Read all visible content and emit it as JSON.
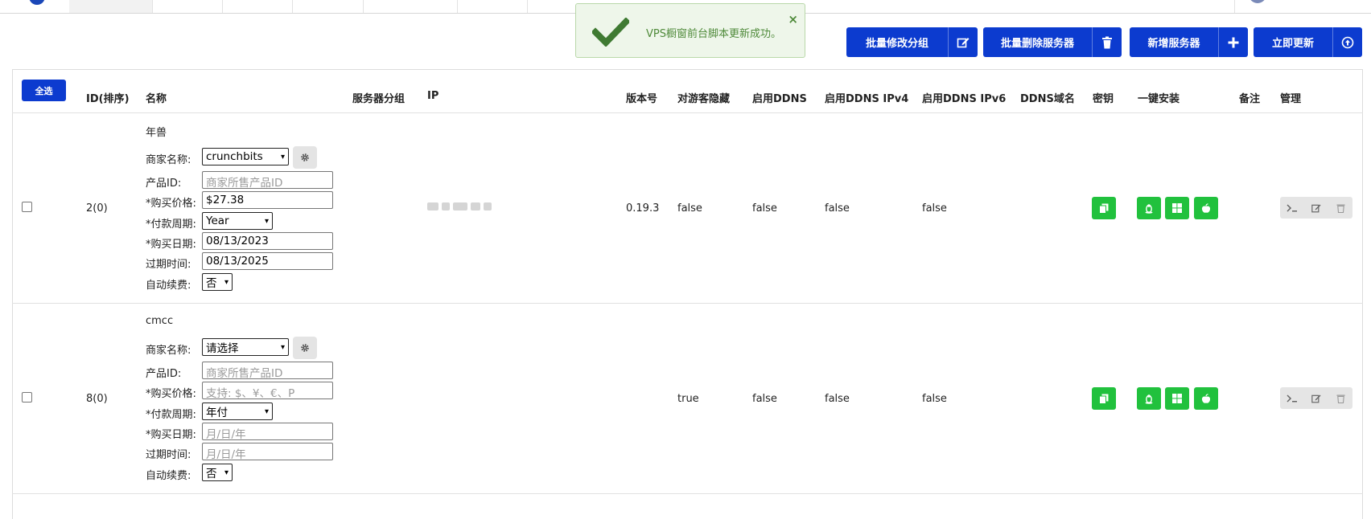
{
  "toast": {
    "message": "VPS橱窗前台脚本更新成功。",
    "close": "×"
  },
  "toolbar": {
    "batch_group": "批量修改分组",
    "batch_delete": "批量删除服务器",
    "add_server": "新增服务器",
    "update_now": "立即更新"
  },
  "table": {
    "select_all": "全选",
    "headers": {
      "id": "ID(排序)",
      "name": "名称",
      "group": "服务器分组",
      "ip": "IP",
      "version": "版本号",
      "hide": "对游客隐藏",
      "ddns": "启用DDNS",
      "ddns4": "启用DDNS IPv4",
      "ddns6": "启用DDNS IPv6",
      "ddns_domain": "DDNS域名",
      "secret": "密钥",
      "install": "一键安装",
      "note": "备注",
      "manage": "管理"
    },
    "labels": {
      "merchant": "商家名称:",
      "product_id": "产品ID:",
      "price": "*购买价格:",
      "cycle": "*付款周期:",
      "buy_date": "*购买日期:",
      "expire": "过期时间:",
      "auto_renew": "自动续费:"
    },
    "rows": [
      {
        "id": "2(0)",
        "name": "年兽",
        "merchant": "crunchbits",
        "product_id_placeholder": "商家所售产品ID",
        "price": "$27.38",
        "cycle": "Year",
        "buy_date": "08/13/2023",
        "expire": "08/13/2025",
        "auto_renew": "否",
        "version": "0.19.3",
        "hide": "false",
        "ddns": "false",
        "ddns4": "false",
        "ddns6": "false"
      },
      {
        "id": "8(0)",
        "name": "cmcc",
        "merchant": "请选择",
        "product_id_placeholder": "商家所售产品ID",
        "price_placeholder": "支持: $、¥、€、P",
        "cycle": "年付",
        "buy_date_placeholder": "月/日/年",
        "expire_placeholder": "月/日/年",
        "auto_renew": "否",
        "version": "",
        "hide": "true",
        "ddns": "false",
        "ddns4": "false",
        "ddns6": "false"
      }
    ]
  }
}
